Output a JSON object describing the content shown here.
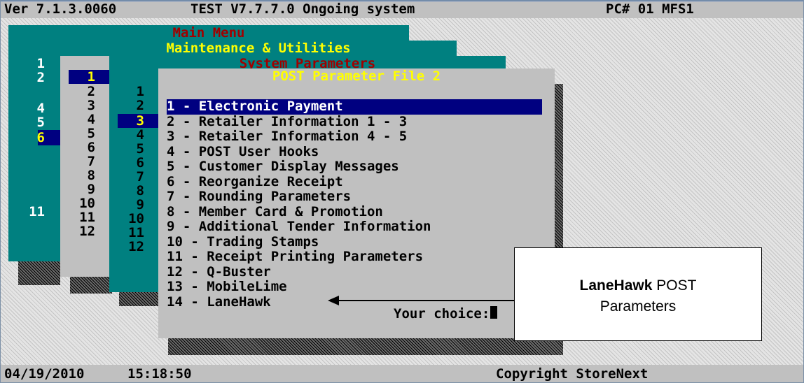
{
  "status_bar": {
    "version": "Ver 7.1.3.0060",
    "system": "TEST V7.7.7.0 Ongoing system",
    "pc": "PC# 01 MFS1"
  },
  "footer": {
    "date": "04/19/2010",
    "time": "15:18:50",
    "copyright": "Copyright StoreNext"
  },
  "main_menu": {
    "title": "Main Menu",
    "numbers": [
      "1",
      "2",
      "4",
      "5",
      "6",
      "11"
    ],
    "selected": "6"
  },
  "maintenance_menu": {
    "title": "Maintenance & Utilities",
    "numbers": [
      "1",
      "2",
      "3",
      "4",
      "5",
      "6",
      "7",
      "8",
      "9",
      "10",
      "11",
      "12"
    ],
    "selected": "1"
  },
  "system_parameters_menu": {
    "title": "System Parameters",
    "numbers": [
      "1",
      "2",
      "3",
      "4",
      "5",
      "6",
      "7",
      "8",
      "9",
      "10",
      "11",
      "12"
    ],
    "selected": "3"
  },
  "post_parameter_menu": {
    "title": "POST Parameter File 2",
    "items": [
      "1 - Electronic Payment",
      "2 - Retailer Information 1 - 3",
      "3 - Retailer Information 4 - 5",
      "4 - POST User Hooks",
      "5 - Customer Display Messages",
      "6 - Reorganize Receipt",
      "7 - Rounding Parameters",
      "8 - Member Card & Promotion",
      "9 - Additional Tender Information",
      "10 - Trading Stamps",
      "11 - Receipt Printing Parameters",
      "12 - Q-Buster",
      "13 - MobileLime",
      "14 - LaneHawk"
    ],
    "selected_index": 0,
    "prompt": "Your choice:"
  },
  "callout": {
    "bold": "LaneHawk",
    "rest": " POST",
    "line2": "Parameters"
  },
  "colors": {
    "teal": "#008080",
    "grey": "#c0c0c0",
    "navy": "#000080",
    "title_red": "#a00000",
    "title_yellow": "#ffff00"
  }
}
